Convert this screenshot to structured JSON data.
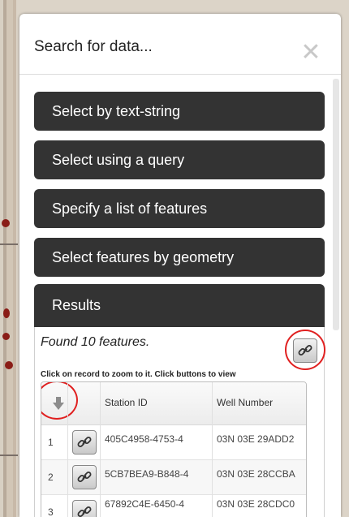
{
  "panel": {
    "title": "Search for data...",
    "close_icon": "close-icon"
  },
  "accordion": [
    {
      "label": "Select by text-string"
    },
    {
      "label": "Select using a query"
    },
    {
      "label": "Specify a list of features"
    },
    {
      "label": "Select features by geometry"
    }
  ],
  "results": {
    "header": "Results",
    "found_text": "Found 10 features.",
    "hint": "Click on record to zoom to it. Click buttons to view",
    "columns": [
      "Station ID",
      "Well Number"
    ],
    "rows": [
      {
        "index": "1",
        "station_id": "405C4958-4753-4",
        "well_number": "03N 03E 29ADD2"
      },
      {
        "index": "2",
        "station_id": "5CB7BEA9-B848-4",
        "well_number": "03N 03E 28CCBA"
      },
      {
        "index": "3",
        "station_id": "67892C4E-6450-4",
        "well_number": "03N 03E 28CDC0"
      }
    ]
  },
  "colors": {
    "accordion_bg": "#333333",
    "highlight": "#e02020"
  }
}
